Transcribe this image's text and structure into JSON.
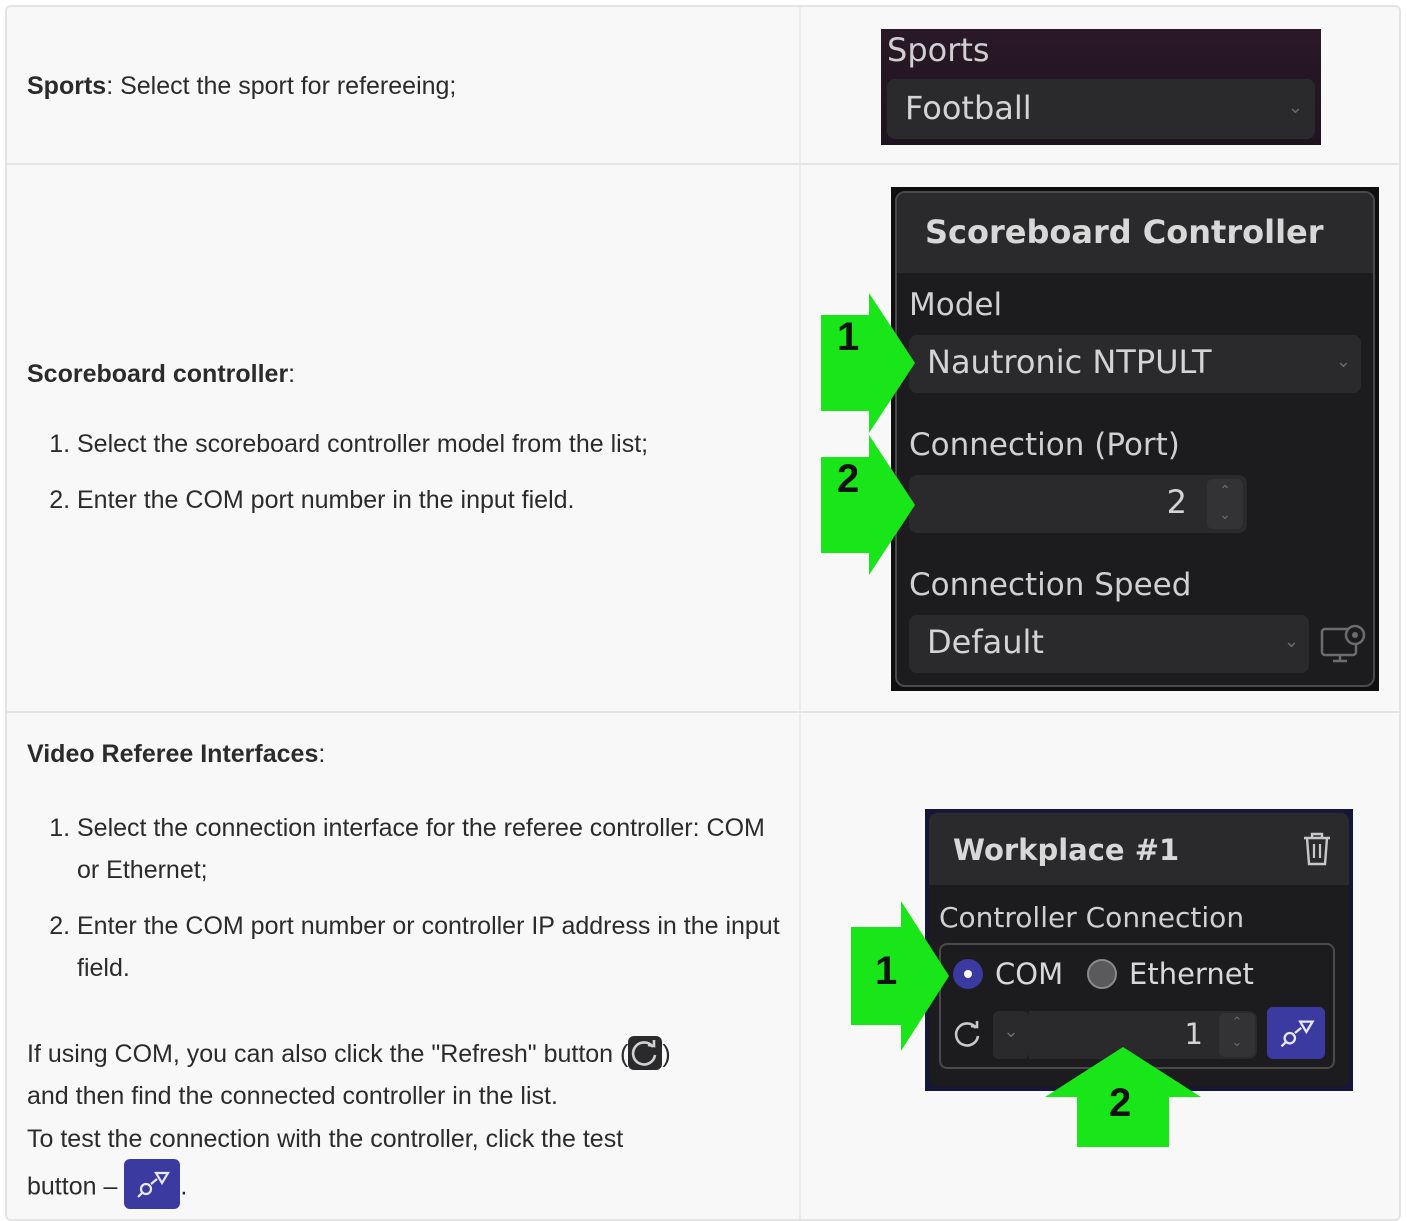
{
  "rows": [
    {
      "bold": "Sports",
      "text": ": Select the sport for refereeing;",
      "widget": {
        "label": "Sports",
        "value": "Football"
      }
    },
    {
      "bold": "Scoreboard controller",
      "text": ":",
      "steps": [
        "Select the scoreboard controller model from the list;",
        "Enter the COM port number in the input field."
      ],
      "widget": {
        "title": "Scoreboard Controller",
        "model_label": "Model",
        "model_value": "Nautronic NTPULT",
        "port_label": "Connection (Port)",
        "port_value": "2",
        "speed_label": "Connection Speed",
        "speed_value": "Default",
        "marker_1": "1",
        "marker_2": "2"
      }
    },
    {
      "bold": "Video Referee Interfaces",
      "text": ":",
      "steps": [
        "Select the connection interface for the referee controller: COM or Ethernet;",
        "Enter the COM port number or controller IP address in the input field."
      ],
      "note_1a": "If using COM, you can also click the \"Refresh\" button (",
      "note_1b": ")",
      "note_2": "and then find the connected controller in the list.",
      "note_3": "To test the connection with the controller, click the test",
      "note_4a": "button –",
      "note_4b": ".",
      "widget": {
        "title": "Workplace #1",
        "section_label": "Controller Connection",
        "opt_com": "COM",
        "opt_eth": "Ethernet",
        "selected": "COM",
        "port_value": "1",
        "marker_1": "1",
        "marker_2": "2"
      }
    }
  ],
  "colors": {
    "arrow": "#19e619",
    "accent": "#3a3aa0",
    "panel": "#1c1c1e"
  }
}
